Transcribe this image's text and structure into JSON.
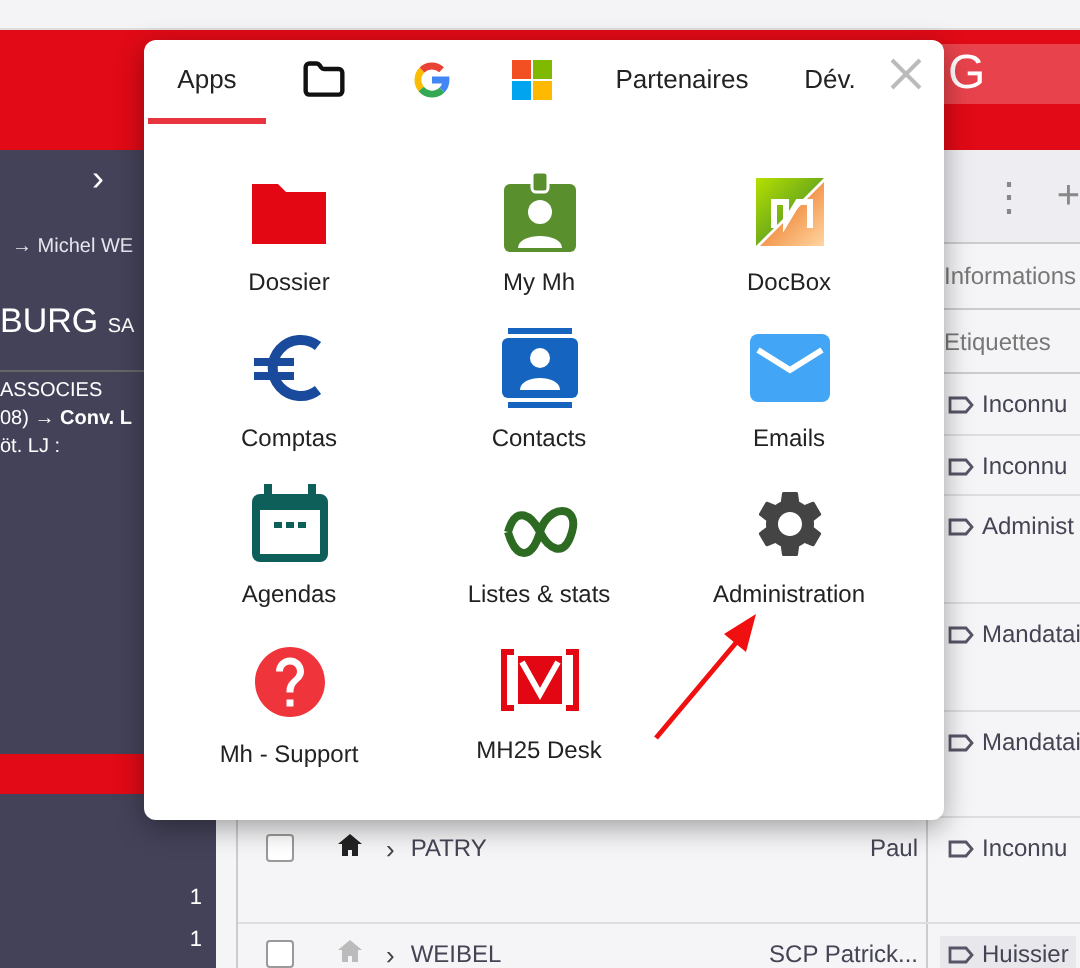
{
  "header": {
    "search_value": "G"
  },
  "sidebar": {
    "expand_icon": "›",
    "lines": [
      {
        "kind": "link",
        "text": "→ Michel WE"
      },
      {
        "kind": "title",
        "text": "BURG",
        "suffix": "SA"
      },
      {
        "kind": "section",
        "text": "ASSOCIES"
      },
      {
        "kind": "rich",
        "text": "08) → **Conv. L**"
      },
      {
        "kind": "plain",
        "text": "öt. LJ :"
      }
    ],
    "counts": [
      "1",
      "1"
    ]
  },
  "toolbar": {
    "more": "⋮",
    "add": "+"
  },
  "table": {
    "headers": [
      "Informations",
      "Etiquettes"
    ],
    "rows": [
      {
        "tag": "Inconnu",
        "highlight": false
      },
      {
        "tag": "Inconnu",
        "highlight": false
      },
      {
        "tag": "Administ",
        "highlight": false
      },
      {
        "tag": "Mandatai",
        "highlight": false
      },
      {
        "tag": "Mandatai",
        "highlight": false
      },
      {
        "tag": "Inconnu",
        "highlight": false,
        "checked": false,
        "expand": "›",
        "name": "PATRY",
        "owner": "Paul",
        "home_active": true
      },
      {
        "tag": "Huissier",
        "highlight": true,
        "checked": false,
        "expand": "›",
        "name": "WEIBEL",
        "owner": "SCP Patrick...",
        "home_active": false
      }
    ]
  },
  "launcher": {
    "tabs": [
      {
        "kind": "text",
        "label": "Apps",
        "selected": true
      },
      {
        "kind": "folder",
        "selected": false
      },
      {
        "kind": "google",
        "selected": false
      },
      {
        "kind": "microsoft",
        "selected": false
      },
      {
        "kind": "text",
        "label": "Partenaires",
        "selected": false
      },
      {
        "kind": "text",
        "label": "Dév.",
        "selected": false
      }
    ],
    "apps": [
      {
        "kind": "folder",
        "label": "Dossier"
      },
      {
        "kind": "badge",
        "label": "My Mh"
      },
      {
        "kind": "docbox",
        "label": "DocBox"
      },
      {
        "kind": "euro",
        "label": "Comptas"
      },
      {
        "kind": "contact",
        "label": "Contacts"
      },
      {
        "kind": "mail",
        "label": "Emails"
      },
      {
        "kind": "calendar",
        "label": "Agendas"
      },
      {
        "kind": "loop",
        "label": "Listes & stats"
      },
      {
        "kind": "gear",
        "label": "Administration"
      },
      {
        "kind": "help",
        "label": "Mh - Support"
      },
      {
        "kind": "desk",
        "label": "MH25 Desk"
      }
    ]
  }
}
